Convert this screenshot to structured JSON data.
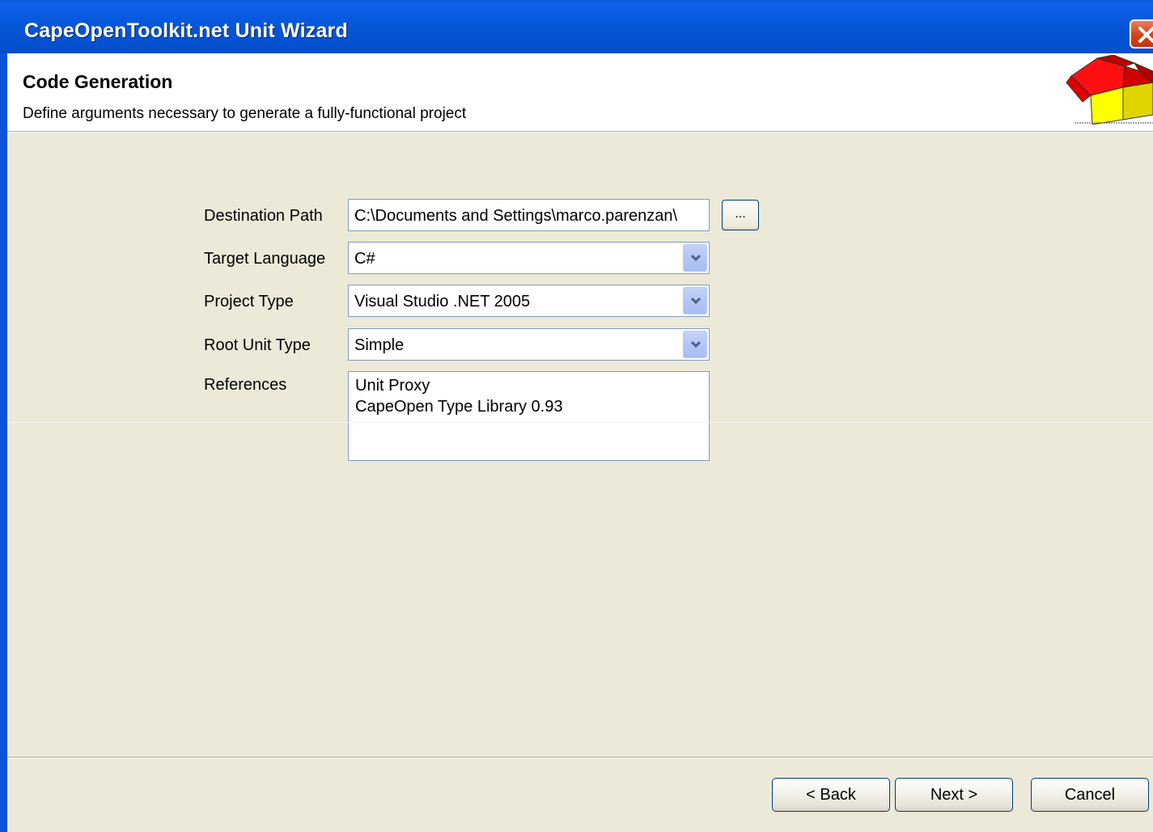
{
  "window": {
    "title": "CapeOpenToolkit.net Unit Wizard"
  },
  "header": {
    "title": "Code Generation",
    "subtitle": "Define arguments necessary to generate a fully-functional project"
  },
  "form": {
    "destination_path": {
      "label": "Destination Path",
      "value": "C:\\Documents and Settings\\marco.parenzan\\",
      "browse_label": "..."
    },
    "target_language": {
      "label": "Target Language",
      "value": "C#"
    },
    "project_type": {
      "label": "Project Type",
      "value": "Visual Studio .NET 2005"
    },
    "root_unit_type": {
      "label": "Root Unit Type",
      "value": "Simple"
    },
    "references": {
      "label": "References",
      "items": [
        "Unit Proxy",
        "CapeOpen Type Library 0.93"
      ]
    }
  },
  "footer": {
    "back_label": "< Back",
    "next_label": "Next >",
    "cancel_label": "Cancel"
  },
  "colors": {
    "titlebar": "#0553d6",
    "dialog_bg": "#ece9d8",
    "header_bg": "#ffffff"
  }
}
